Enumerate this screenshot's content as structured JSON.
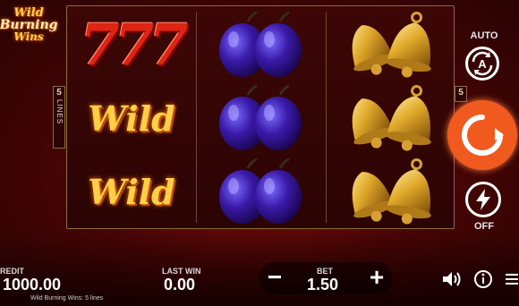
{
  "logo": {
    "line1": "Wild",
    "line2": "Burning",
    "line3": "Wins"
  },
  "paylines": {
    "left_num": "5",
    "left_word": "LINES",
    "right_num": "5"
  },
  "reels": [
    {
      "symbols": [
        "seven",
        "wild",
        "wild"
      ]
    },
    {
      "symbols": [
        "plum",
        "plum",
        "plum"
      ]
    },
    {
      "symbols": [
        "bell",
        "bell",
        "bell"
      ]
    }
  ],
  "symbol_text": {
    "seven": "777",
    "wild": "Wild"
  },
  "controls": {
    "auto_label": "AUTO",
    "auto_letter": "A",
    "turbo_label": "OFF"
  },
  "credit": {
    "label": "REDIT",
    "value": "1000.00"
  },
  "last_win": {
    "label": "LAST WIN",
    "value": "0.00"
  },
  "bet": {
    "label": "BET",
    "value": "1.50",
    "minus": "−",
    "plus": "+"
  },
  "footer": {
    "text": "Wild Burning Wins: 5 lines"
  },
  "colors": {
    "spin": "#f05a1e",
    "background": "#4a0505",
    "gold": "#ffcf4a",
    "plum": "#3a1a9a"
  },
  "icons": [
    "spin-icon",
    "auto-icon",
    "turbo-lightning-icon",
    "sound-icon",
    "info-icon",
    "menu-icon",
    "plum-icon",
    "bell-icon"
  ]
}
